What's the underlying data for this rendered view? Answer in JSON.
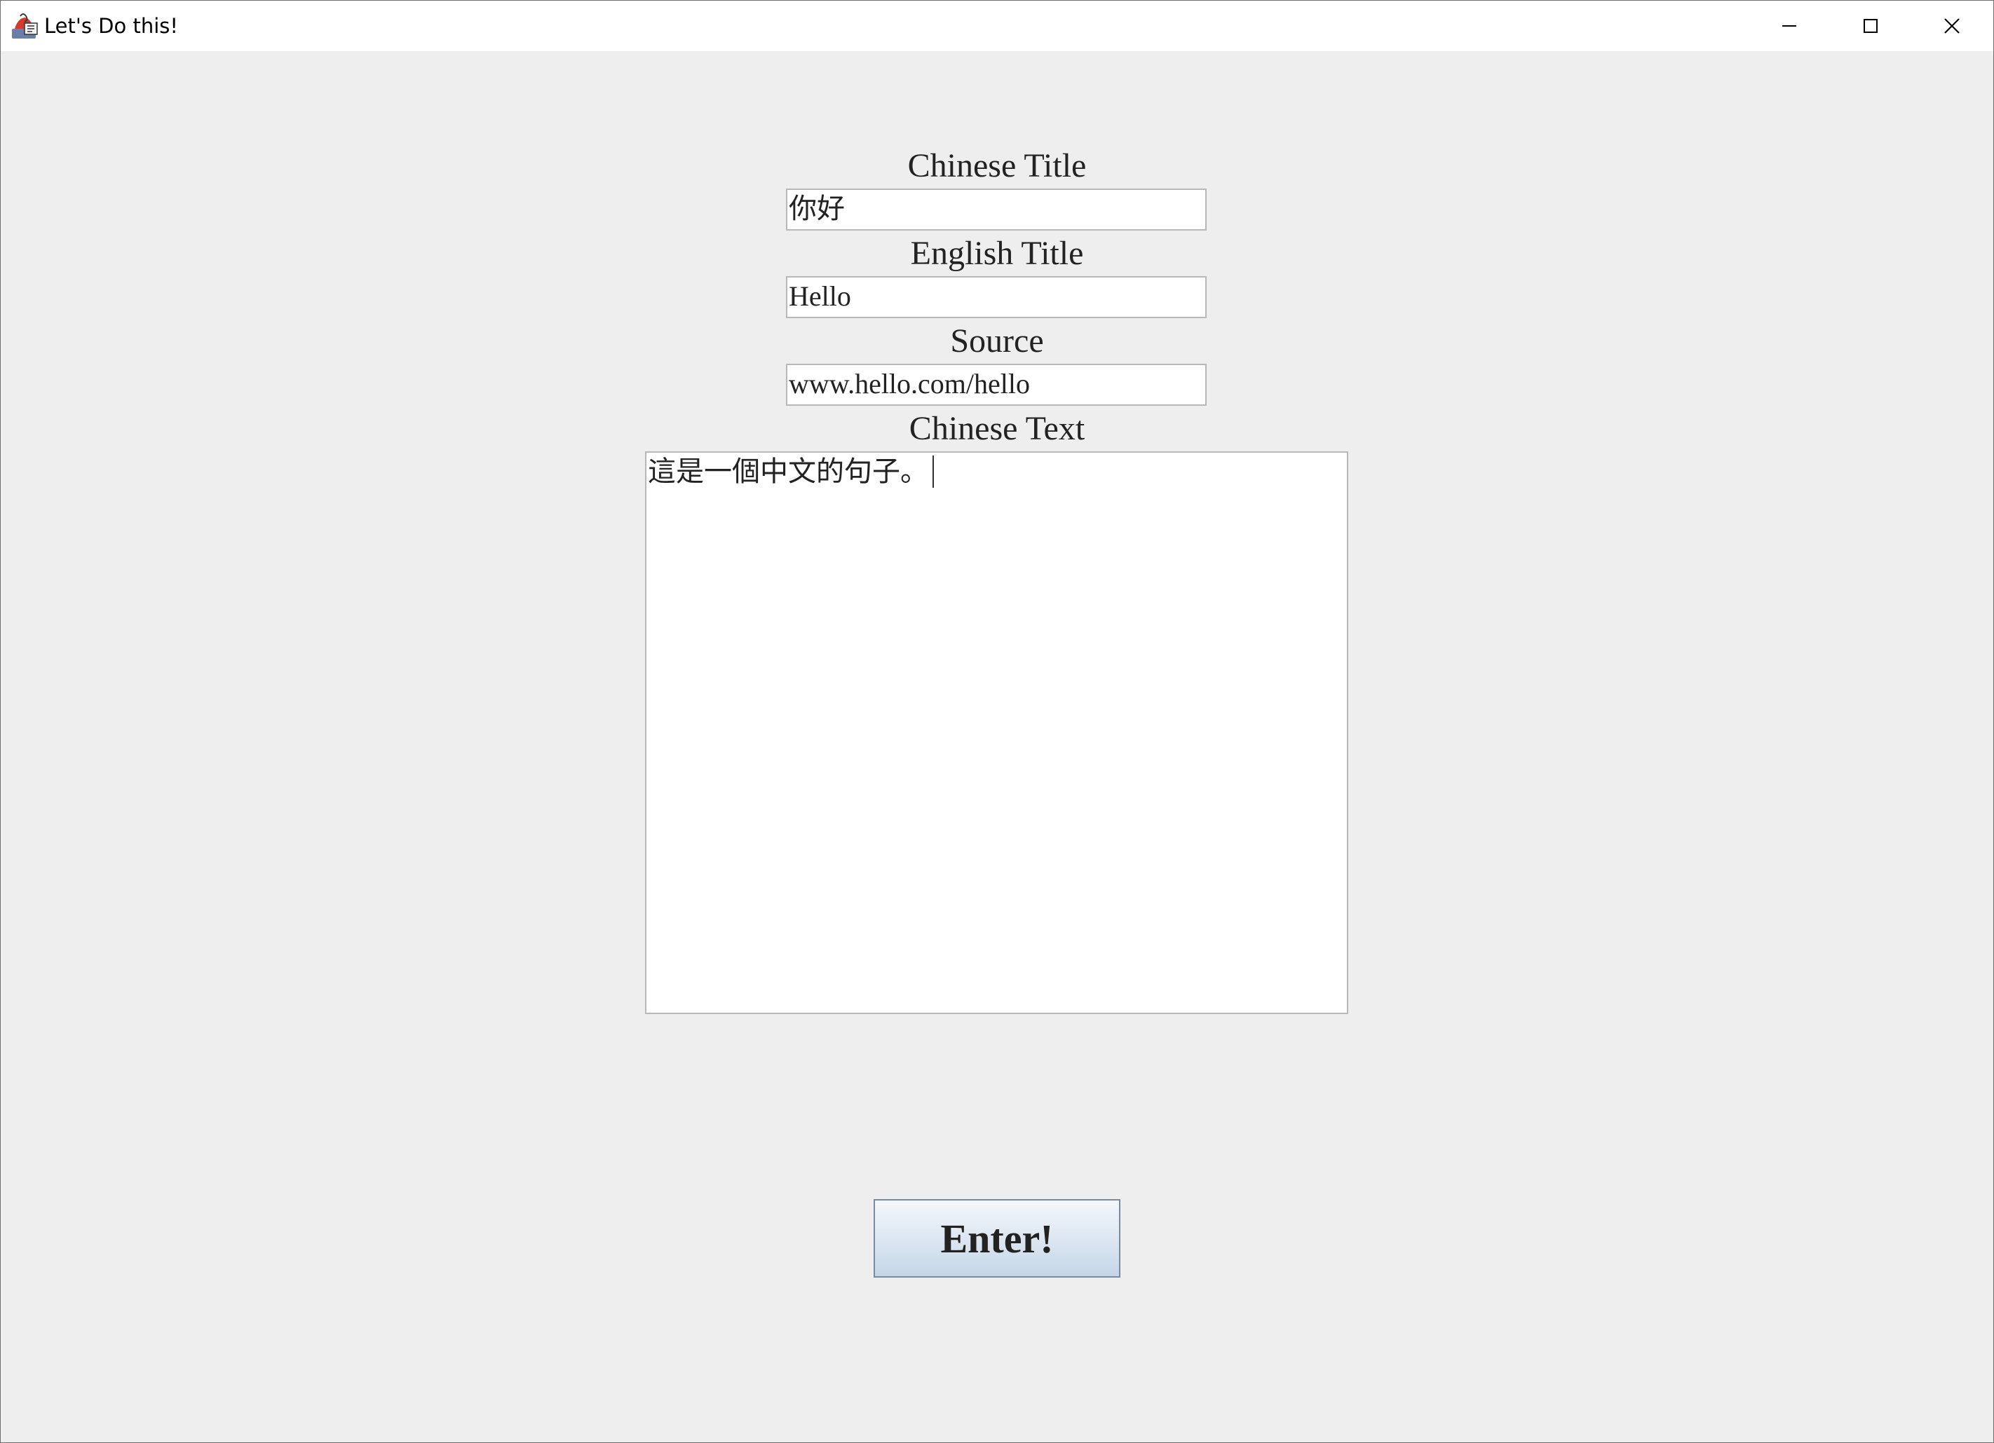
{
  "window": {
    "title": "Let's Do this!"
  },
  "form": {
    "chinese_title": {
      "label": "Chinese Title",
      "value": "你好"
    },
    "english_title": {
      "label": "English Title",
      "value": "Hello"
    },
    "source": {
      "label": "Source",
      "value": "www.hello.com/hello"
    },
    "chinese_text": {
      "label": "Chinese Text",
      "value": "這是一個中文的句子。"
    },
    "enter_label": "Enter!"
  },
  "icons": {
    "app": "java-cup-icon",
    "minimize": "minimize-icon",
    "maximize": "maximize-icon",
    "close": "close-icon"
  },
  "colors": {
    "window_bg": "#eeeeee",
    "titlebar_bg": "#ffffff",
    "field_bg": "#ffffff",
    "button_gradient_top": "#f4f7fb",
    "button_gradient_bottom": "#c5d6e8"
  }
}
